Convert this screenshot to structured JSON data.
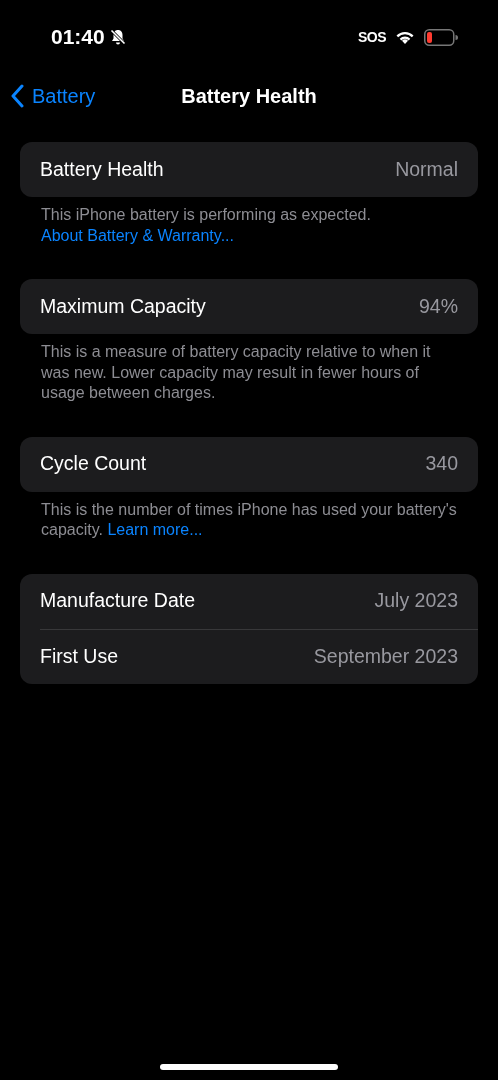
{
  "status_bar": {
    "time": "01:40",
    "carrier": "SOS"
  },
  "nav": {
    "back": "Battery",
    "title": "Battery Health"
  },
  "sections": [
    {
      "rows": [
        {
          "label": "Battery Health",
          "value": "Normal"
        }
      ],
      "footer": {
        "text": "This iPhone battery is performing as expected.",
        "link": "About Battery & Warranty..."
      }
    },
    {
      "rows": [
        {
          "label": "Maximum Capacity",
          "value": "94%"
        }
      ],
      "footer": {
        "text": "This is a measure of battery capacity relative to when it was new. Lower capacity may result in fewer hours of usage between charges."
      }
    },
    {
      "rows": [
        {
          "label": "Cycle Count",
          "value": "340"
        }
      ],
      "footer": {
        "text": "This is the number of times iPhone has used your battery's capacity.",
        "link": "Learn more..."
      }
    },
    {
      "rows": [
        {
          "label": "Manufacture Date",
          "value": "July 2023"
        },
        {
          "label": "First Use",
          "value": "September 2023"
        }
      ]
    }
  ]
}
